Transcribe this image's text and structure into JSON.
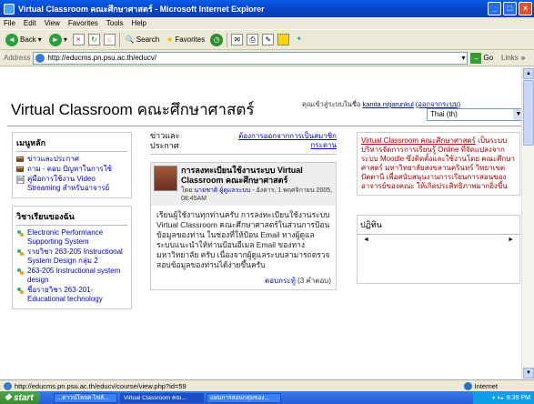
{
  "window": {
    "title": "Virtual Classroom คณะศึกษาศาสตร์ - Microsoft Internet Explorer"
  },
  "menu": [
    "File",
    "Edit",
    "View",
    "Favorites",
    "Tools",
    "Help"
  ],
  "toolbar": {
    "back": "Back",
    "search": "Search",
    "favorites": "Favorites"
  },
  "address": {
    "label": "Address",
    "url": "http://educms.pn.psu.ac.th/educv/",
    "go": "Go",
    "links": "Links"
  },
  "header": {
    "site_title": "Virtual Classroom คณะศึกษาศาสตร์",
    "login_prefix": "คุณเข้าสู่ระบบในชื่อ",
    "user_name": "kanita nitjarunkul",
    "logout": "(ออกจากระบบ)",
    "language": "Thai (th)"
  },
  "main_menu": {
    "title": "เมนูหลัก",
    "items": [
      {
        "label": "ข่าวและประกาศ",
        "icon": "forum-icon"
      },
      {
        "label": "ถาม - ตอบ ปัญหาในการใช้",
        "icon": "forum-icon"
      },
      {
        "label": "คู่มือการใช้งาน Video Streaming สำหรับอาจารย์",
        "icon": "document-icon"
      }
    ]
  },
  "my_courses": {
    "title": "วิชาเรียนของฉัน",
    "items": [
      {
        "label": "Electronic Performance Supporting System",
        "icon": "course-icon"
      },
      {
        "label": "รายวิชา 263-205 Instructional System Design กลุ่ม 2",
        "icon": "course-icon"
      },
      {
        "label": "263-205 Instructional system design",
        "icon": "course-icon"
      },
      {
        "label": "ชื่อรายวิชา 263-201- Educational technology",
        "icon": "course-icon"
      }
    ]
  },
  "news": {
    "title": "ข่าวและประกาศ",
    "subscribe": "ต้องการออกจากการเป็นสมาชิกกระดาน",
    "post": {
      "subject": "การลงทะเบียนใช้งานระบบ Virtual Classroom คณะศึกษาศาสตร์",
      "by": "โดย",
      "author": "นายชาติ ผู้ดูแลระบบ",
      "date": "- อังคาร, 1 พฤศจิกายน 2005, 08:45AM",
      "body": "เรียนผู้ใช้งานทุกท่านครับ การลงทะเบียนใช้งานระบบ Virtual Classroom คณะศึกษาศาสตร์ในส่วนการป้อนข้อมูลของท่าน ในช่องที่ให้ป้อน Email ทางผู้ดูแลระบบแนะนำให้ท่านป้อนอีเมล Email ของทางมหาวิทยาลัย ครับ เนื่องจากผู้ดูแลระบบสามารถตรวจสอบข้อมูลของท่านได้ง่ายขึ้นครับ",
      "reply": "ตอบกระทู้",
      "reply_count": "(3 คำตอบ)"
    }
  },
  "about_block": {
    "text_highlight": "Virtual Classroom คณะศึกษาศาสตร์",
    "text": "เป็นระบบบริหารจัดการการเรียนรู้ Online ที่จัดแปลงจากระบบ Moodle ซึ่งติดตั้งและใช้งานโดย คณะศึกษาศาสตร์ มหาวิทยาลัยสงขลานครินทร์ วิทยาเขตปัตตานี เพื่อสนับสนุนงานการเรียนการสอนของอาจารย์ของคณะ ให้เกิดประสิทธิภาพมากยิ่งขึ้น"
  },
  "calendar": {
    "title": "ปฏิทิน",
    "prev": "◄",
    "next": "►"
  },
  "status": {
    "url": "http://educms.pn.psu.ac.th/educv/course/view.php?id=59",
    "zone": "Internet"
  },
  "taskbar": {
    "start": "start",
    "tasks": [
      "...ดาวน์โหลด ไฟล์...",
      "Virtual Classroom คณ...",
      "แผนการสอนกลุ่มของ..."
    ],
    "clock": "8:39 PM"
  },
  "colors": {
    "link": "#0000cc",
    "title_bar": "#0a5ce6",
    "highlight_text": "#aa0000"
  }
}
